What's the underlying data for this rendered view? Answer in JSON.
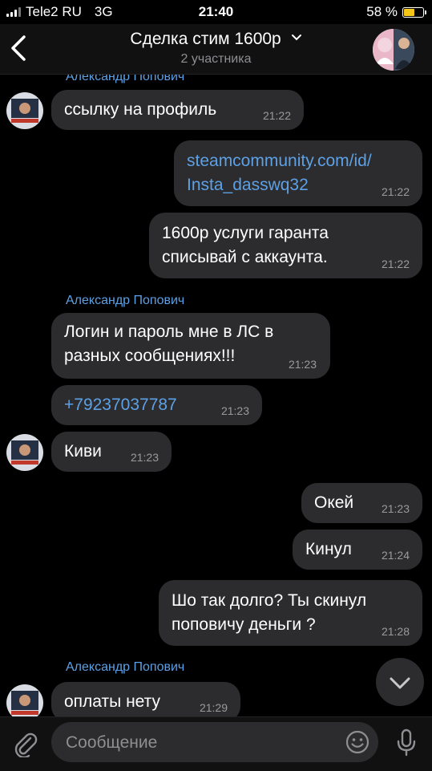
{
  "status_bar": {
    "carrier": "Tele2 RU",
    "network": "3G",
    "time": "21:40",
    "battery": "58 %",
    "battery_level": 0.58,
    "battery_color": "#f5c518"
  },
  "header": {
    "title": "Сделка стим 1600р",
    "subtitle": "2 участника"
  },
  "messages": [
    {
      "sender": "Александр Попович"
    },
    {
      "text": "ссылку на профиль",
      "time": "21:22"
    },
    {
      "text": "steamcommunity.com/id/\nInsta_dasswq32",
      "time": "21:22"
    },
    {
      "text": "1600р услуги гаранта\nсписывай с аккаунта.",
      "time": "21:22"
    },
    {
      "sender": "Александр Попович"
    },
    {
      "text": "Логин и пароль мне в ЛС в\nразных сообщениях!!!",
      "time": "21:23"
    },
    {
      "text": "+79237037787",
      "time": "21:23"
    },
    {
      "text": "Киви",
      "time": "21:23"
    },
    {
      "text": "Окей",
      "time": "21:23"
    },
    {
      "text": "Кинул",
      "time": "21:24"
    },
    {
      "text": "Шо так долго? Ты скинул\nпоповичу деньги ?",
      "time": "21:28"
    },
    {
      "sender": "Александр Попович"
    },
    {
      "text": "оплаты нету",
      "time": "21:29"
    }
  ],
  "input": {
    "placeholder": "Сообщение"
  },
  "colors": {
    "accent": "#5da0e4",
    "bubble": "#2c2c2e",
    "background": "#000000"
  }
}
